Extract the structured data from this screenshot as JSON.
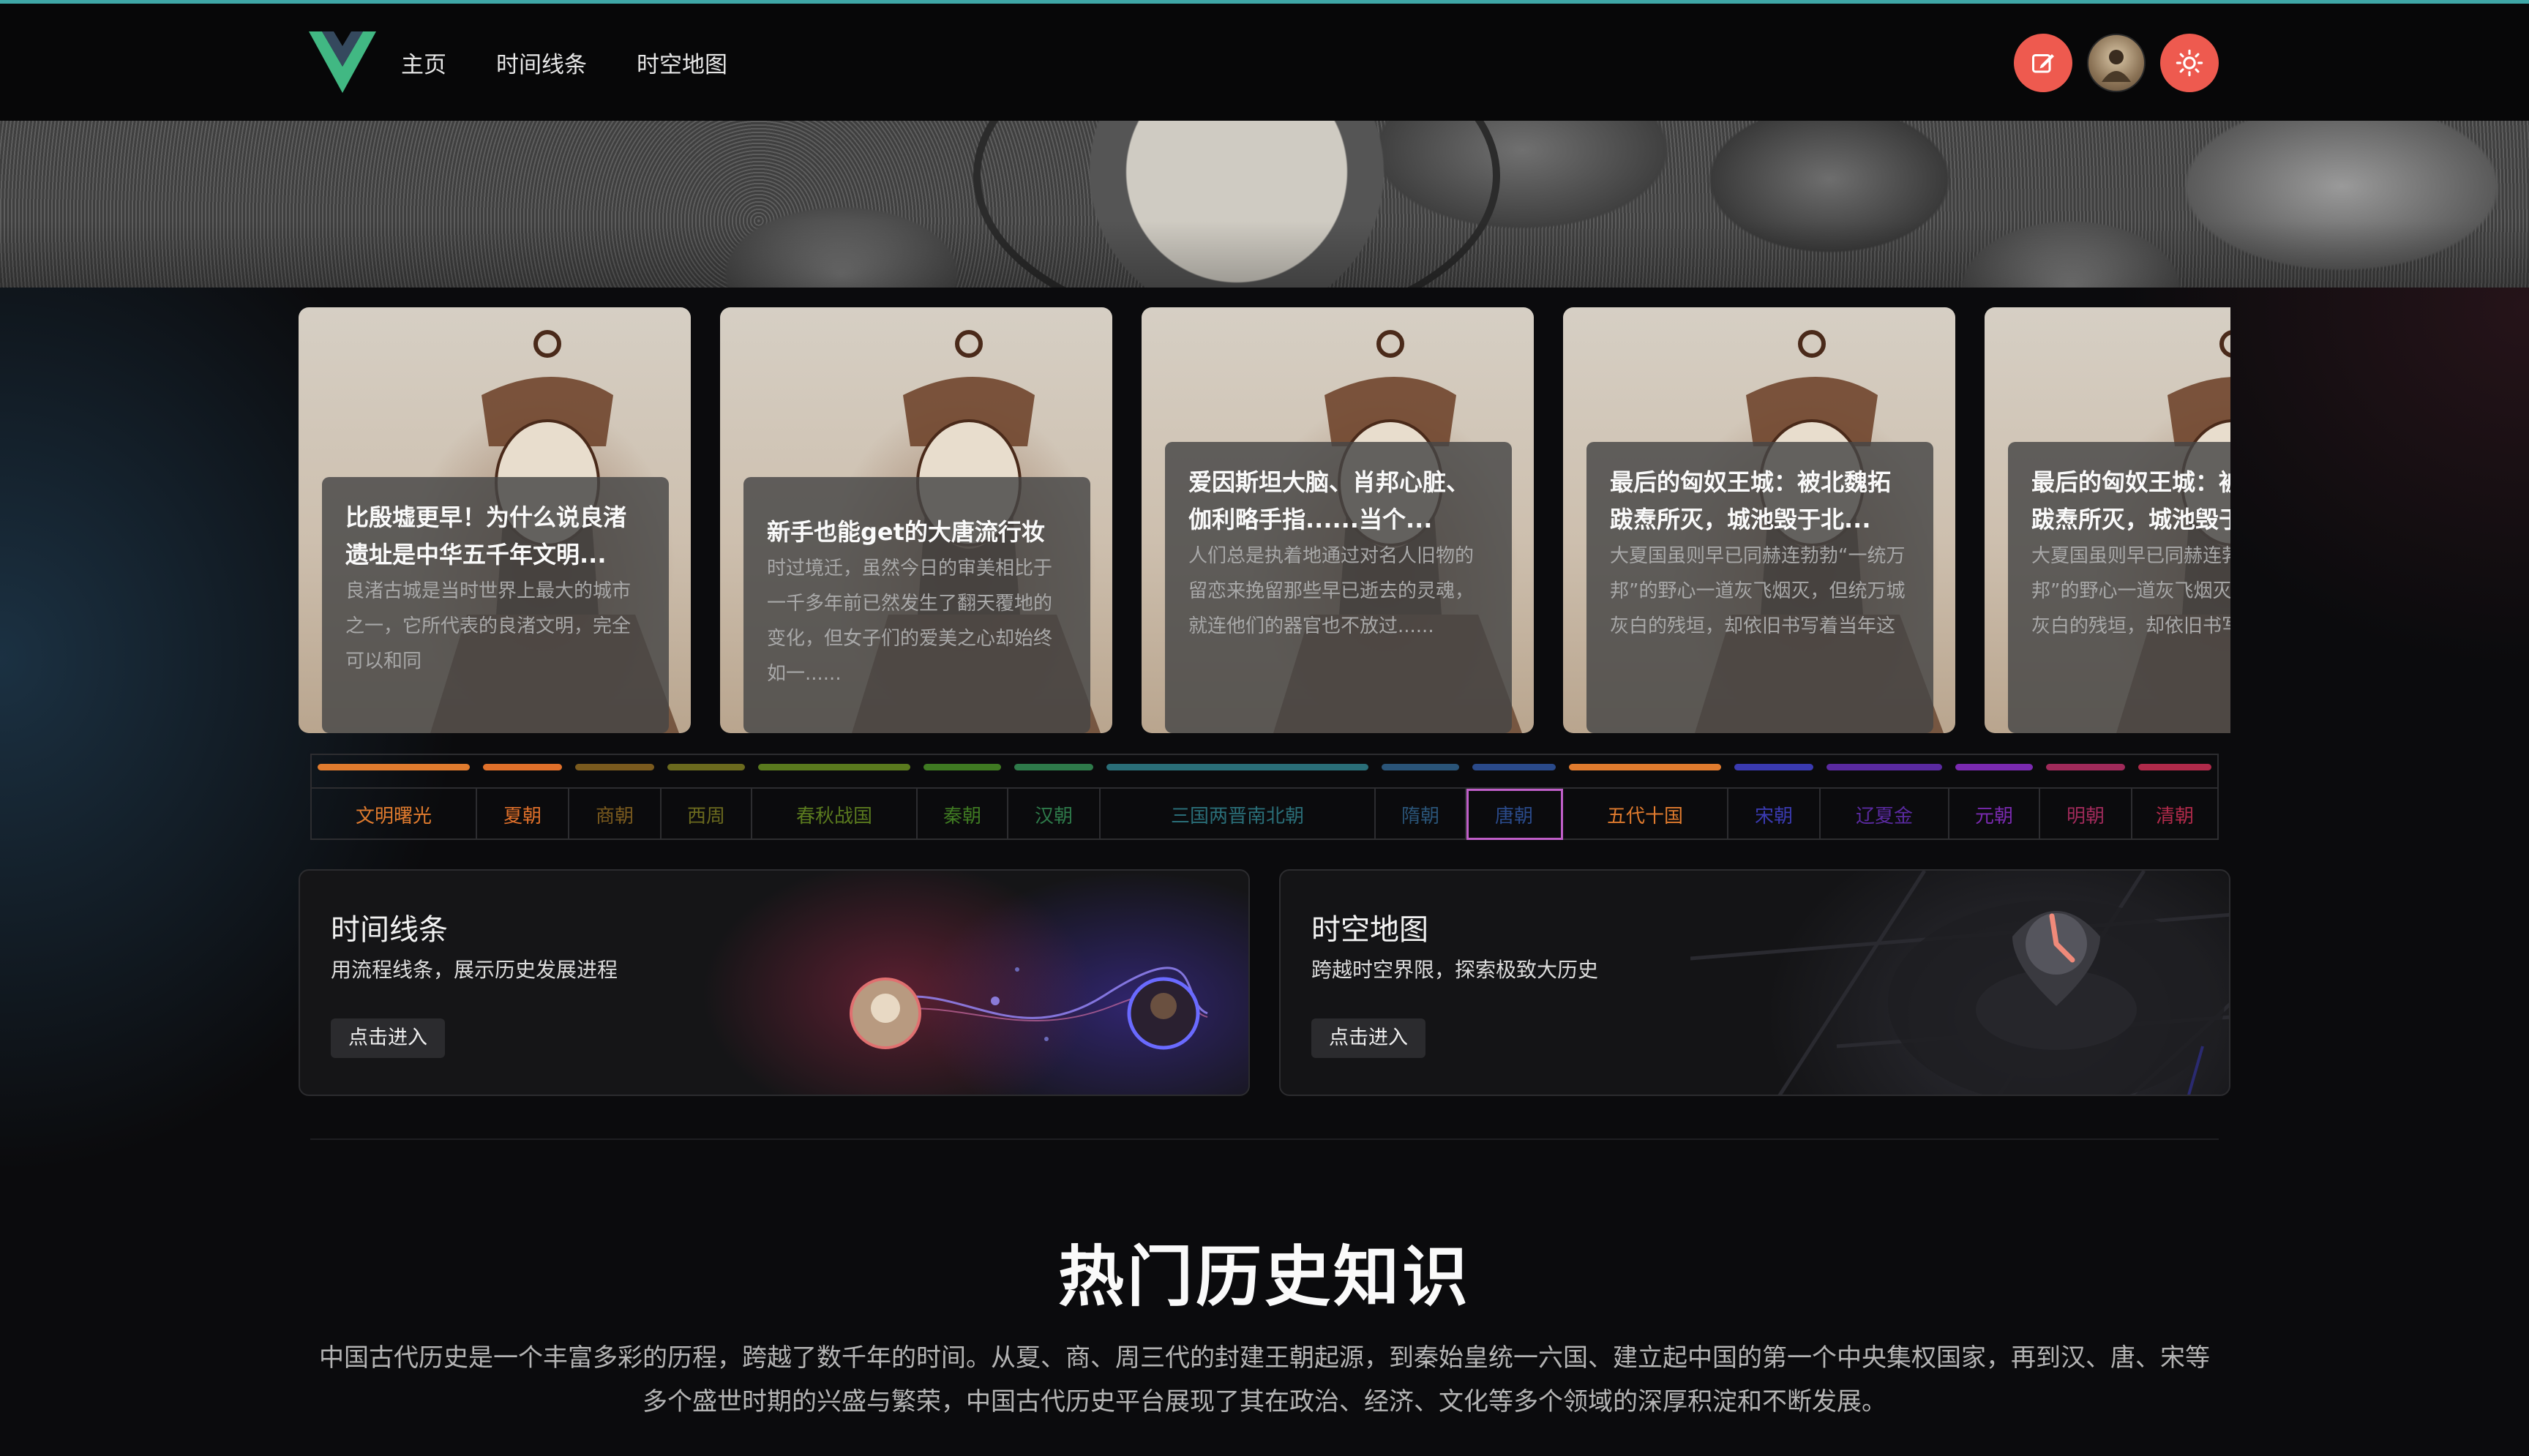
{
  "nav": {
    "items": [
      "主页",
      "时间线条",
      "时空地图"
    ]
  },
  "header": {
    "edit_icon": "edit-icon",
    "avatar_icon": "user-avatar",
    "theme_icon": "sun-icon",
    "accent_color": "#ee5a4f"
  },
  "carousel": {
    "cards": [
      {
        "title": "比殷墟更早！为什么说良渚遗址是中华五千年文明...",
        "desc": "良渚古城是当时世界上最大的城市之一，它所代表的良渚文明，完全可以和同"
      },
      {
        "title": "新手也能get的大唐流行妆",
        "desc": "时过境迁，虽然今日的审美相比于一千多年前已然发生了翻天覆地的变化，但女子们的爱美之心却始终如一......"
      },
      {
        "title": "爱因斯坦大脑、肖邦心脏、伽利略手指......当个...",
        "desc": "人们总是执着地通过对名人旧物的留恋来挽留那些早已逝去的灵魂，就连他们的器官也不放过......"
      },
      {
        "title": "最后的匈奴王城：被北魏拓跋焘所灭，城池毁于北...",
        "desc": "大夏国虽则早已同赫连勃勃“一统万邦”的野心一道灰飞烟灭，但统万城灰白的残垣，却依旧书写着当年这群匈奴人的辉煌......"
      },
      {
        "title": "最后的匈奴王城：被北魏拓跋焘所灭，城池毁于北...",
        "desc": "大夏国虽则早已同赫连勃勃“一统万邦”的野心一道灰飞烟灭，但统万城灰白的残垣，却依旧书写着当年这群匈奴人的辉煌......"
      }
    ]
  },
  "dynasties": [
    {
      "label": "文明曙光",
      "color": "#e07b2e"
    },
    {
      "label": "夏朝",
      "color": "#e0702a"
    },
    {
      "label": "商朝",
      "color": "#7a5a1e"
    },
    {
      "label": "西周",
      "color": "#6b6a1e"
    },
    {
      "label": "春秋战国",
      "color": "#5a7a1e"
    },
    {
      "label": "秦朝",
      "color": "#3f7a22"
    },
    {
      "label": "汉朝",
      "color": "#2e7a4a"
    },
    {
      "label": "三国两晋南北朝",
      "color": "#2a6e78"
    },
    {
      "label": "隋朝",
      "color": "#2a5478"
    },
    {
      "label": "唐朝",
      "color": "#2a4a8a"
    },
    {
      "label": "五代十国",
      "color": "#e07b2e"
    },
    {
      "label": "宋朝",
      "color": "#3a3ab0"
    },
    {
      "label": "辽夏金",
      "color": "#5a2aa0"
    },
    {
      "label": "元朝",
      "color": "#7a2ab0"
    },
    {
      "label": "明朝",
      "color": "#a02a5a"
    },
    {
      "label": "清朝",
      "color": "#b02a4a"
    }
  ],
  "dynasty_active": "唐朝",
  "features": {
    "timeline": {
      "title": "时间线条",
      "desc": "用流程线条，展示历史发展进程",
      "button": "点击进入"
    },
    "map": {
      "title": "时空地图",
      "desc": "跨越时空界限，探索极致大历史",
      "button": "点击进入"
    }
  },
  "hot": {
    "title": "热门历史知识",
    "desc": "中国古代历史是一个丰富多彩的历程，跨越了数千年的时间。从夏、商、周三代的封建王朝起源，到秦始皇统一六国、建立起中国的第一个中央集权国家，再到汉、唐、宋等多个盛世时期的兴盛与繁荣，中国古代历史平台展现了其在政治、经济、文化等多个领域的深厚积淀和不断发展。"
  }
}
